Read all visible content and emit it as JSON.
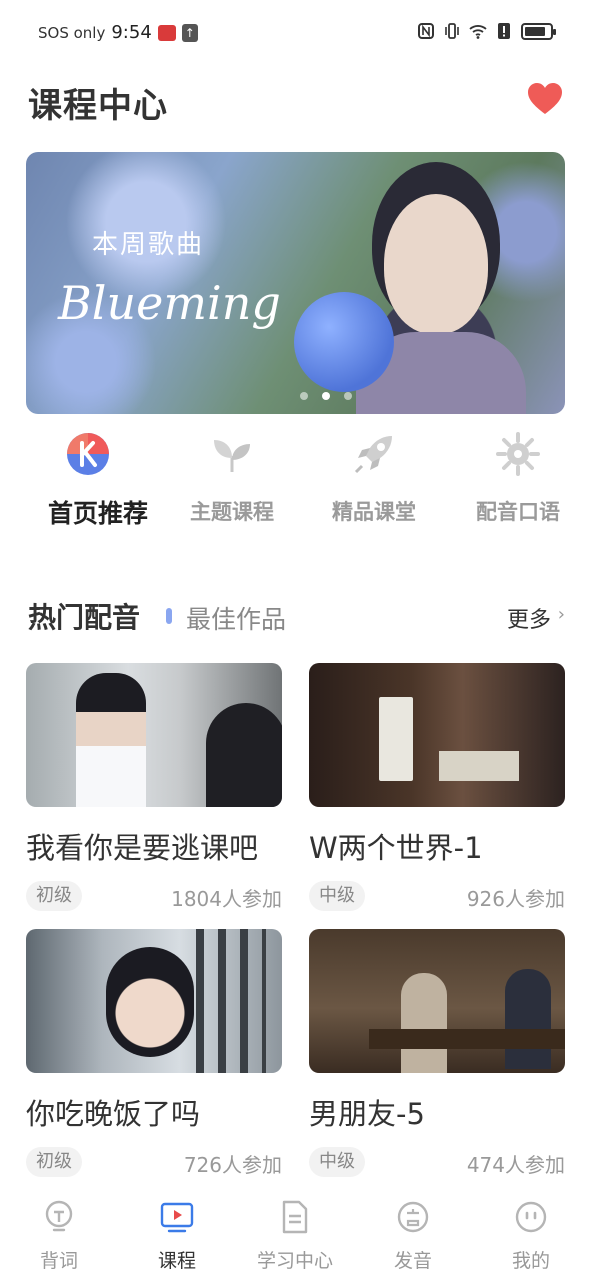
{
  "status_bar": {
    "carrier": "SOS only",
    "time": "9:54"
  },
  "header": {
    "title": "课程中心",
    "favorite_icon": "heart-icon",
    "favorite_color": "#ef5b57"
  },
  "banner": {
    "subtitle": "本周歌曲",
    "title": "Blueming",
    "page_count": 3,
    "active_page": 2
  },
  "categories": [
    {
      "label": "首页推荐",
      "icon": "k-logo-icon",
      "active": true
    },
    {
      "label": "主题课程",
      "icon": "sprout-icon",
      "active": false
    },
    {
      "label": "精品课堂",
      "icon": "rocket-icon",
      "active": false
    },
    {
      "label": "配音口语",
      "icon": "film-reel-icon",
      "active": false
    }
  ],
  "section": {
    "title": "热门配音",
    "subtitle": "最佳作品",
    "more": "更多",
    "accent": "#8aa6f0"
  },
  "cards": [
    {
      "title": "我看你是要逃课吧",
      "level": "初级",
      "participants": "1804人参加"
    },
    {
      "title": "W两个世界-1",
      "level": "中级",
      "participants": "926人参加"
    },
    {
      "title": "你吃晚饭了吗",
      "level": "初级",
      "participants": "726人参加"
    },
    {
      "title": "男朋友-5",
      "level": "中级",
      "participants": "474人参加"
    }
  ],
  "bottom_nav": [
    {
      "label": "背词",
      "icon": "lightbulb-icon",
      "active": false
    },
    {
      "label": "课程",
      "icon": "video-play-icon",
      "active": true
    },
    {
      "label": "学习中心",
      "icon": "document-icon",
      "active": false
    },
    {
      "label": "发音",
      "icon": "speech-icon",
      "active": false
    },
    {
      "label": "我的",
      "icon": "profile-face-icon",
      "active": false
    }
  ],
  "colors": {
    "active_nav": "#3b7be8",
    "inactive": "#999999",
    "k_logo_red": "#f05a5a",
    "k_logo_blue": "#5b7fe6"
  }
}
